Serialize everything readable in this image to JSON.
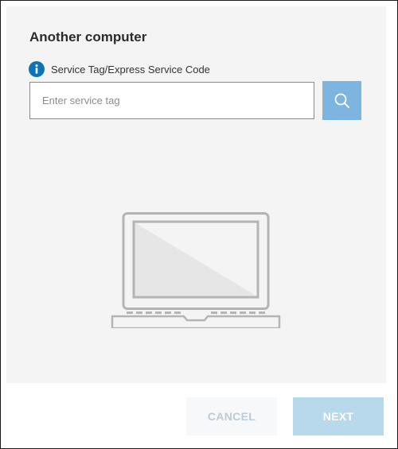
{
  "dialog": {
    "title": "Another computer"
  },
  "service_tag": {
    "info_icon": "info-icon",
    "label": "Service Tag/Express Service Code",
    "value": "",
    "placeholder": "Enter service tag",
    "search_icon": "search-icon"
  },
  "illustration": {
    "icon": "laptop-icon"
  },
  "footer": {
    "cancel_label": "CANCEL",
    "next_label": "NEXT"
  },
  "colors": {
    "info_icon": "#0e72b7",
    "search_button": "#7db5e0",
    "next_button_disabled": "#b8d8ec",
    "panel_background": "#f4f4f4"
  }
}
